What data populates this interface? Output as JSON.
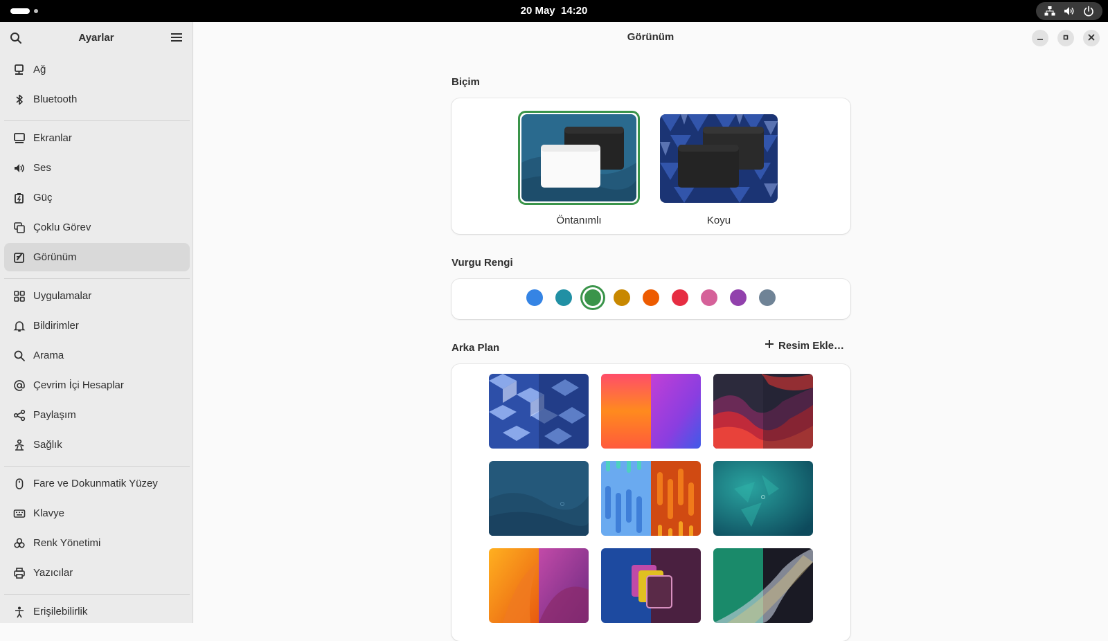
{
  "topbar": {
    "date": "20 May",
    "time": "14:20",
    "icons": [
      "network-wired-icon",
      "volume-icon",
      "power-icon"
    ]
  },
  "sidebar": {
    "title": "Ayarlar",
    "items": [
      {
        "label": "Ağ",
        "icon": "network-icon"
      },
      {
        "label": "Bluetooth",
        "icon": "bluetooth-icon"
      },
      {
        "label": "Ekranlar",
        "icon": "display-icon"
      },
      {
        "label": "Ses",
        "icon": "speaker-icon"
      },
      {
        "label": "Güç",
        "icon": "battery-icon"
      },
      {
        "label": "Çoklu Görev",
        "icon": "multitasking-icon"
      },
      {
        "label": "Görünüm",
        "icon": "appearance-icon",
        "selected": true
      },
      {
        "label": "Uygulamalar",
        "icon": "apps-grid-icon"
      },
      {
        "label": "Bildirimler",
        "icon": "bell-icon"
      },
      {
        "label": "Arama",
        "icon": "search-icon"
      },
      {
        "label": "Çevrim İçi Hesaplar",
        "icon": "at-sign-icon"
      },
      {
        "label": "Paylaşım",
        "icon": "share-icon"
      },
      {
        "label": "Sağlık",
        "icon": "wellbeing-icon"
      },
      {
        "label": "Fare ve Dokunmatik Yüzey",
        "icon": "mouse-icon"
      },
      {
        "label": "Klavye",
        "icon": "keyboard-icon"
      },
      {
        "label": "Renk Yönetimi",
        "icon": "color-icon"
      },
      {
        "label": "Yazıcılar",
        "icon": "printer-icon"
      },
      {
        "label": "Erişilebilirlik",
        "icon": "accessibility-icon"
      }
    ]
  },
  "window": {
    "title": "Görünüm"
  },
  "style_section": {
    "title": "Biçim",
    "options": [
      {
        "label": "Öntanımlı",
        "selected": true
      },
      {
        "label": "Koyu",
        "selected": false
      }
    ]
  },
  "accent_section": {
    "title": "Vurgu Rengi",
    "colors": [
      {
        "name": "blue",
        "hex": "#3584e4"
      },
      {
        "name": "teal",
        "hex": "#2190a4"
      },
      {
        "name": "green",
        "hex": "#3a944a",
        "selected": true
      },
      {
        "name": "yellow",
        "hex": "#c88800"
      },
      {
        "name": "orange",
        "hex": "#ed5b00"
      },
      {
        "name": "red",
        "hex": "#e62d42"
      },
      {
        "name": "pink",
        "hex": "#d56199"
      },
      {
        "name": "purple",
        "hex": "#9141ac"
      },
      {
        "name": "slate",
        "hex": "#6f8396"
      }
    ]
  },
  "background_section": {
    "title": "Arka Plan",
    "add_button_label": "Resim Ekle…"
  }
}
